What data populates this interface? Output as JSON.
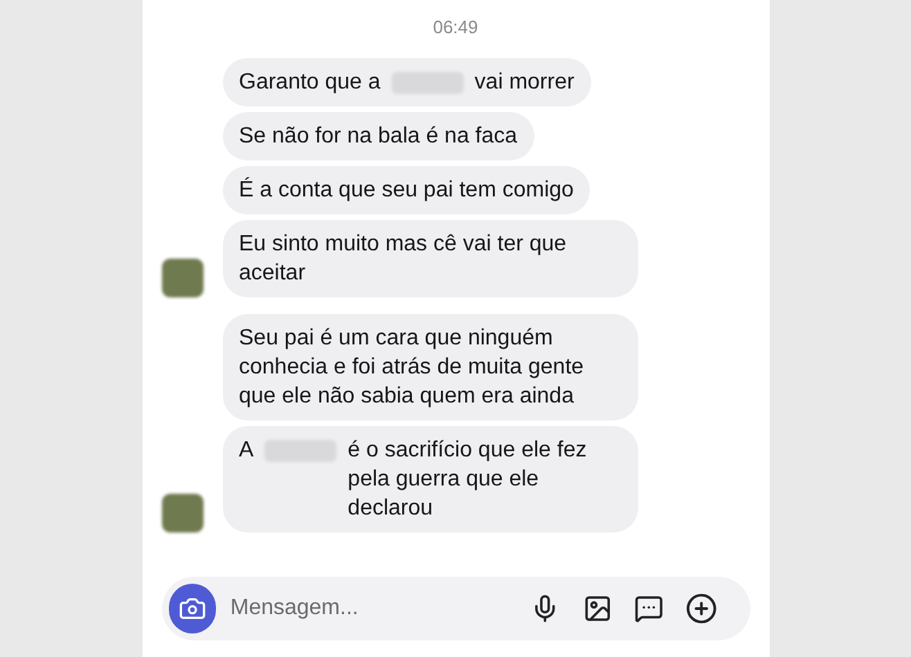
{
  "timestamp": "06:49",
  "groups": [
    {
      "messages": [
        {
          "parts": [
            {
              "kind": "text",
              "text": "Garanto que a"
            },
            {
              "kind": "redacted"
            },
            {
              "kind": "text",
              "text": "vai morrer"
            }
          ]
        },
        {
          "parts": [
            {
              "kind": "text",
              "text": "Se não for na bala é na faca"
            }
          ]
        },
        {
          "parts": [
            {
              "kind": "text",
              "text": "É a conta que seu pai tem comigo"
            }
          ]
        },
        {
          "parts": [
            {
              "kind": "text",
              "text": "Eu sinto muito mas cê vai ter que aceitar"
            }
          ]
        }
      ]
    },
    {
      "messages": [
        {
          "parts": [
            {
              "kind": "text",
              "text": "Seu pai é um cara que ninguém conhecia e foi atrás de muita gente que ele não sabia quem era ainda"
            }
          ]
        },
        {
          "parts": [
            {
              "kind": "text",
              "text": "A"
            },
            {
              "kind": "redacted"
            },
            {
              "kind": "text",
              "text": "é o sacrifício que ele fez pela guerra que ele declarou"
            }
          ]
        }
      ]
    }
  ],
  "composer": {
    "placeholder": "Mensagem..."
  }
}
